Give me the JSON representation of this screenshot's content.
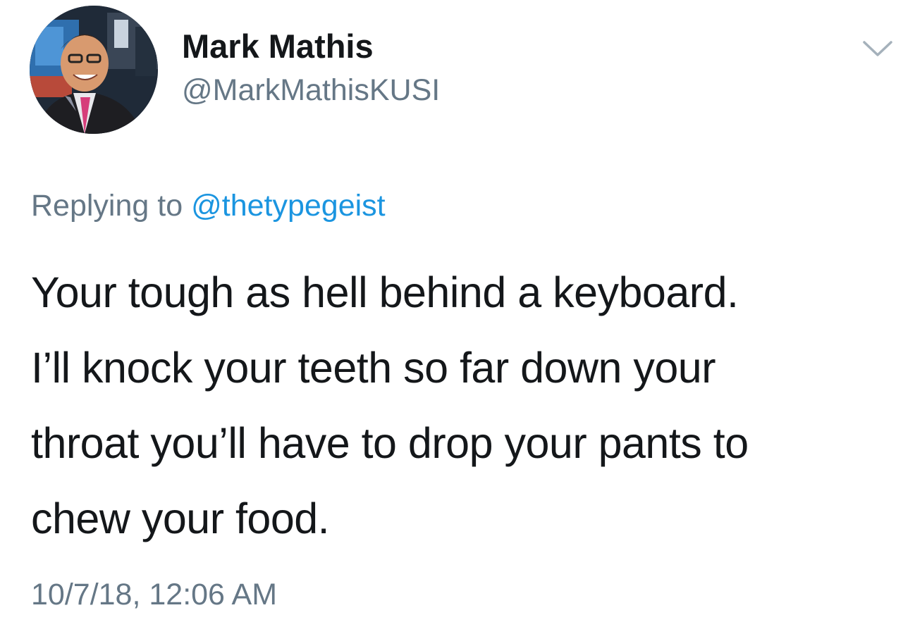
{
  "tweet": {
    "author": {
      "display_name": "Mark Mathis",
      "handle": "@MarkMathisKUSI",
      "avatar": "user-avatar-photo"
    },
    "menu_icon": "chevron-down-icon",
    "reply": {
      "prefix": "Replying to",
      "mention": "@thetypegeist"
    },
    "text_lines": [
      "Your tough as hell behind a keyboard.",
      "I’ll knock your teeth so far down your",
      "throat you’ll have to drop your pants to",
      "chew your food."
    ],
    "timestamp": "10/7/18, 12:06 AM"
  },
  "colors": {
    "primary_text": "#14171a",
    "secondary_text": "#657786",
    "link": "#1b95e0",
    "chevron": "#a5b1bb"
  }
}
